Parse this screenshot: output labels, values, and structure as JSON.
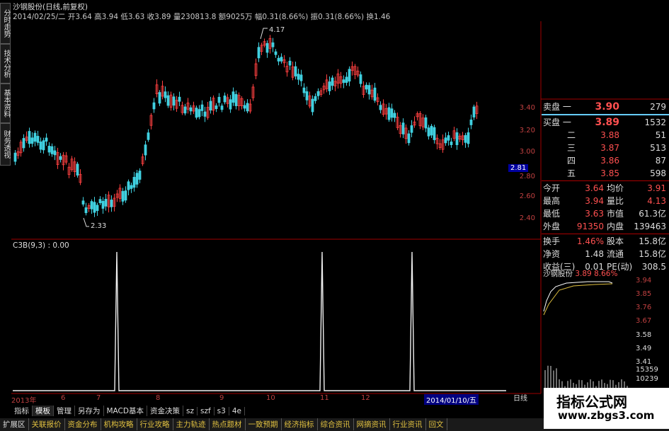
{
  "tabs_left": [
    "分时走势",
    "技术分析",
    "基本资料",
    "财务透视"
  ],
  "info": {
    "title": "沙钢股份(日线,前复权)",
    "date": "2014/02/25/二",
    "open_l": "开",
    "open": "3.64",
    "high_l": "高",
    "high": "3.94",
    "low_l": "低",
    "low": "3.63",
    "close_l": "收",
    "close": "3.89",
    "vol_l": "量",
    "vol": "230813.8",
    "amt_l": "额",
    "amt": "9025万",
    "chg_l": "幅",
    "chg": "0.31(8.66%)",
    "amp_l": "振",
    "amp": "0.31(8.66%)",
    "turn_l": "换",
    "turn": "1.46"
  },
  "y_labels": [
    "3.40",
    "3.20",
    "3.00",
    "2.80",
    "2.60",
    "2.40"
  ],
  "current_price": "2.81",
  "high_mark": "4.17",
  "low_mark": "2.33",
  "indicator_label": "C3B(9,3) : 0.00",
  "quote": {
    "sell_label": "卖盘",
    "sell": [
      {
        "n": "一",
        "p": "3.90",
        "v": "279"
      }
    ],
    "buy_label": "买盘",
    "buy": [
      {
        "n": "一",
        "p": "3.89",
        "v": "1532"
      },
      {
        "n": "二",
        "p": "3.88",
        "v": "51"
      },
      {
        "n": "三",
        "p": "3.87",
        "v": "513"
      },
      {
        "n": "四",
        "p": "3.86",
        "v": "87"
      },
      {
        "n": "五",
        "p": "3.85",
        "v": "598"
      }
    ]
  },
  "stats1": [
    {
      "a": "今开",
      "b": "3.64",
      "c": "均价",
      "d": "3.91",
      "br": true,
      "dr": true
    },
    {
      "a": "最高",
      "b": "3.94",
      "c": "量比",
      "d": "4.13",
      "br": true,
      "dr": true
    },
    {
      "a": "最低",
      "b": "3.63",
      "c": "市值",
      "d": "61.3亿",
      "br": true,
      "dr": false
    },
    {
      "a": "外盘",
      "b": "91350",
      "c": "内盘",
      "d": "139463",
      "br": true,
      "dr": false
    }
  ],
  "stats2": [
    {
      "a": "换手",
      "b": "1.46%",
      "c": "股本",
      "d": "15.8亿"
    },
    {
      "a": "净资",
      "b": "1.48",
      "c": "流通",
      "d": "15.8亿"
    },
    {
      "a": "收益(三)",
      "b": "0.01",
      "c": "PE(动)",
      "d": "308.5"
    }
  ],
  "mini": {
    "name": "沙钢股份",
    "price": "3.89",
    "pct": "8.66%",
    "labels": [
      "3.94",
      "3.85",
      "3.76",
      "3.67",
      "3.58",
      "3.49",
      "3.41"
    ],
    "vol_labels": [
      "15359",
      "10239",
      "5120"
    ]
  },
  "dates": [
    "2013年",
    "6",
    "7",
    "8",
    "9",
    "10",
    "11",
    "12"
  ],
  "date_highlight": "2014/01/10/五",
  "bottom_right": "日线",
  "tabs_row1": [
    "指标",
    "模板",
    "管理",
    "另存为",
    "MACD基本",
    "资金决策",
    "sz",
    "szf",
    "s3",
    "4e"
  ],
  "tabs_row2": [
    "扩展区",
    "关联报价",
    "资金分布",
    "机构攻略",
    "行业攻略",
    "主力轨迹",
    "热点题材",
    "一致预期",
    "经济指标",
    "综合资讯",
    "网摘资讯",
    "行业资讯",
    "回文"
  ],
  "watermark": {
    "line1": "指标公式网",
    "line2": "www.zbgs3.com"
  },
  "colors": {
    "up": "#ff4040",
    "down": "#40d0e0",
    "bg": "#000000",
    "axis": "#a00000"
  }
}
